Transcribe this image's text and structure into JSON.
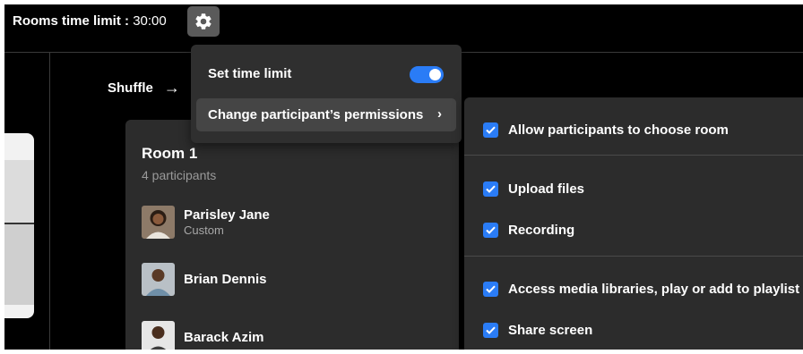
{
  "topbar": {
    "time_limit_label": "Rooms time limit :",
    "time_limit_value": "30:00"
  },
  "shuffle": {
    "label": "Shuffle",
    "arrow": "→"
  },
  "settings_menu": {
    "set_time_limit": "Set time limit",
    "time_limit_enabled": true,
    "change_permissions": "Change participant’s permissions",
    "chevron": "›"
  },
  "permissions": [
    {
      "label": "Allow participants to choose room",
      "checked": true
    },
    {
      "label": "Upload files",
      "checked": true
    },
    {
      "label": "Recording",
      "checked": true
    },
    {
      "label": "Access media libraries, play or add to playlist",
      "checked": true
    },
    {
      "label": "Share screen",
      "checked": true
    }
  ],
  "room": {
    "title": "Room 1",
    "count": "4 participants",
    "participants": [
      {
        "name": "Parisley Jane",
        "role": "Custom"
      },
      {
        "name": "Brian Dennis",
        "role": ""
      },
      {
        "name": "Barack Azim",
        "role": ""
      }
    ]
  },
  "colors": {
    "accent": "#2a7cf6",
    "background": "#000000",
    "panel": "#2c2c2c"
  }
}
